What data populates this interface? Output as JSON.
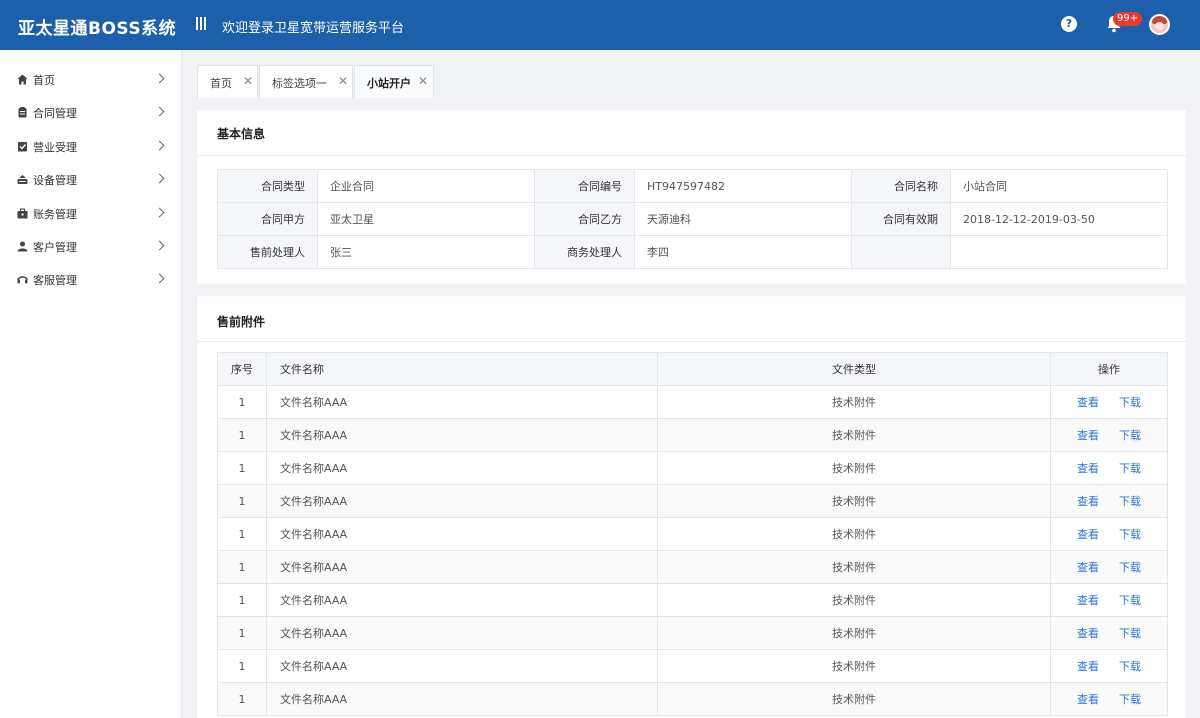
{
  "header": {
    "brand": "亚太星通BOSS系统",
    "title": "欢迎登录卫星宽带运营服务平台",
    "help_icon": "?",
    "notification_count": "99+",
    "bg_color": "#1c5faa"
  },
  "sidebar": {
    "items": [
      {
        "label": "首页",
        "icon": "home-icon"
      },
      {
        "label": "合同管理",
        "icon": "clipboard-icon"
      },
      {
        "label": "营业受理",
        "icon": "check-badge-icon"
      },
      {
        "label": "设备管理",
        "icon": "device-icon"
      },
      {
        "label": "账务管理",
        "icon": "briefcase-icon"
      },
      {
        "label": "客户管理",
        "icon": "user-icon"
      },
      {
        "label": "客服管理",
        "icon": "headset-icon"
      }
    ]
  },
  "tabs": [
    {
      "label": "首页",
      "close": "✕",
      "active": false
    },
    {
      "label": "标签选项一",
      "close": "✕",
      "active": false
    },
    {
      "label": "小站开户",
      "close": "✕",
      "active": true
    }
  ],
  "basic_info": {
    "title": "基本信息",
    "rows": [
      [
        {
          "key": "合同类型",
          "value": "企业合同"
        },
        {
          "key": "合同编号",
          "value": "HT947597482"
        },
        {
          "key": "合同名称",
          "value": "小站合同"
        }
      ],
      [
        {
          "key": "合同甲方",
          "value": "亚太卫星"
        },
        {
          "key": "合同乙方",
          "value": "天源迪科"
        },
        {
          "key": "合同有效期",
          "value": "2018-12-12-2019-03-50"
        }
      ],
      [
        {
          "key": "售前处理人",
          "value": "张三"
        },
        {
          "key": "商务处理人",
          "value": "李四"
        },
        {
          "key": "",
          "value": ""
        }
      ]
    ]
  },
  "attachments": {
    "title": "售前附件",
    "columns": [
      "序号",
      "文件名称",
      "文件类型",
      "操作"
    ],
    "action_view": "查看",
    "action_download": "下载",
    "rows": [
      {
        "idx": "1",
        "name": "文件名称AAA",
        "type": "技术附件"
      },
      {
        "idx": "1",
        "name": "文件名称AAA",
        "type": "技术附件"
      },
      {
        "idx": "1",
        "name": "文件名称AAA",
        "type": "技术附件"
      },
      {
        "idx": "1",
        "name": "文件名称AAA",
        "type": "技术附件"
      },
      {
        "idx": "1",
        "name": "文件名称AAA",
        "type": "技术附件"
      },
      {
        "idx": "1",
        "name": "文件名称AAA",
        "type": "技术附件"
      },
      {
        "idx": "1",
        "name": "文件名称AAA",
        "type": "技术附件"
      },
      {
        "idx": "1",
        "name": "文件名称AAA",
        "type": "技术附件"
      },
      {
        "idx": "1",
        "name": "文件名称AAA",
        "type": "技术附件"
      },
      {
        "idx": "1",
        "name": "文件名称AAA",
        "type": "技术附件"
      }
    ]
  },
  "colors": {
    "link": "#2a74d6",
    "badge": "#e8392f"
  }
}
